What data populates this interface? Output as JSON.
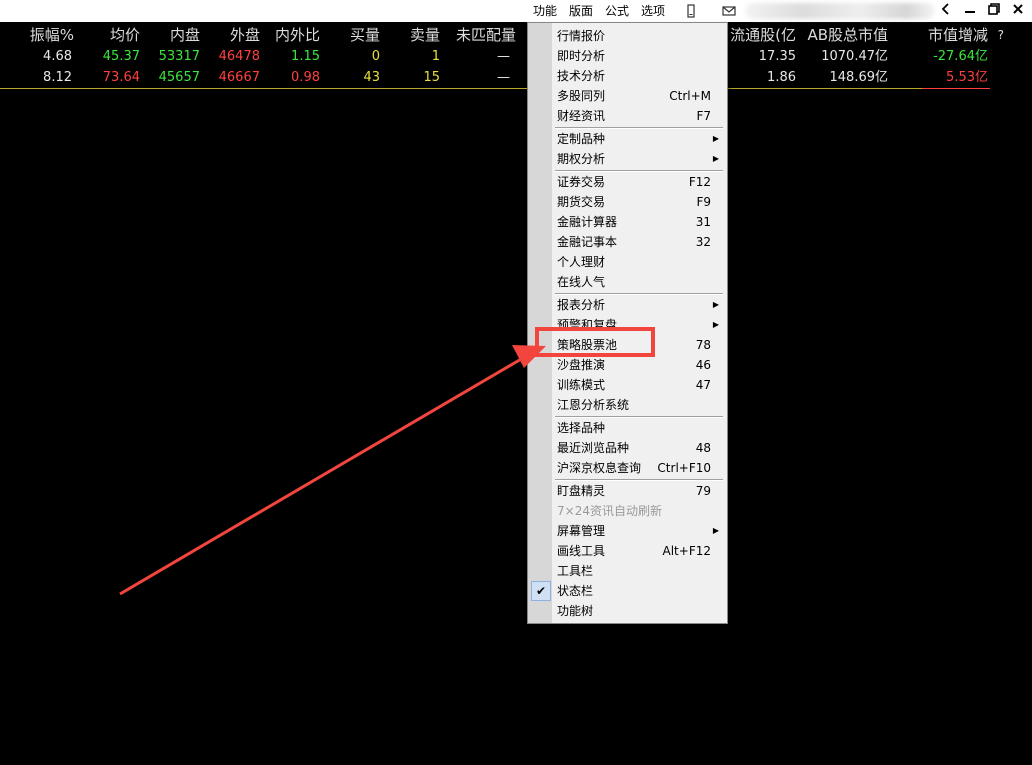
{
  "topmenu": {
    "items": [
      "功能",
      "版面",
      "公式",
      "选项"
    ]
  },
  "window": {
    "help": "?"
  },
  "table": {
    "headers": [
      "振幅%",
      "均价",
      "内盘",
      "外盘",
      "内外比",
      "买量",
      "卖量",
      "未匹配量",
      "流通股(亿",
      "AB股总市值",
      "市值增减"
    ],
    "rows": [
      {
        "amp": "4.68",
        "avg": "45.37",
        "inner": "53317",
        "outer": "46478",
        "ratio": "1.15",
        "buy": "0",
        "sell": "1",
        "unmatched": "—",
        "float": "17.35",
        "mcap": "1070.47亿",
        "delta": "-27.64亿"
      },
      {
        "amp": "8.12",
        "avg": "73.64",
        "inner": "45657",
        "outer": "46667",
        "ratio": "0.98",
        "buy": "43",
        "sell": "15",
        "unmatched": "—",
        "float": "1.86",
        "mcap": "148.69亿",
        "delta": "5.53亿"
      }
    ]
  },
  "menu": {
    "items": [
      {
        "label": "行情报价"
      },
      {
        "label": "即时分析"
      },
      {
        "label": "技术分析"
      },
      {
        "label": "多股同列",
        "shortcut": "Ctrl+M"
      },
      {
        "label": "财经资讯",
        "shortcut": "F7"
      },
      {
        "label": "定制品种",
        "submenu": "▶"
      },
      {
        "label": "期权分析",
        "submenu": "▶"
      },
      {
        "label": "证券交易",
        "shortcut": "F12"
      },
      {
        "label": "期货交易",
        "shortcut": "F9"
      },
      {
        "label": "金融计算器",
        "shortcut": "31"
      },
      {
        "label": "金融记事本",
        "shortcut": "32"
      },
      {
        "label": "个人理财"
      },
      {
        "label": "在线人气"
      },
      {
        "label": "报表分析",
        "submenu": "▶"
      },
      {
        "label": "预警和复盘",
        "submenu": "▶"
      },
      {
        "label": "策略股票池",
        "shortcut": "78"
      },
      {
        "label": "沙盘推演",
        "shortcut": "46"
      },
      {
        "label": "训练模式",
        "shortcut": "47"
      },
      {
        "label": "江恩分析系统"
      },
      {
        "label": "选择品种"
      },
      {
        "label": "最近浏览品种",
        "shortcut": "48"
      },
      {
        "label": "沪深京权息查询",
        "shortcut": "Ctrl+F10"
      },
      {
        "label": "盯盘精灵",
        "shortcut": "79"
      },
      {
        "label": "7×24资讯自动刷新",
        "disabled": true
      },
      {
        "label": "屏幕管理",
        "submenu": "▶"
      },
      {
        "label": "画线工具",
        "shortcut": "Alt+F12"
      },
      {
        "label": "工具栏"
      },
      {
        "label": "状态栏",
        "checked": "✔"
      },
      {
        "label": "功能树"
      }
    ]
  },
  "annotation": {
    "color": "#f2453d"
  }
}
